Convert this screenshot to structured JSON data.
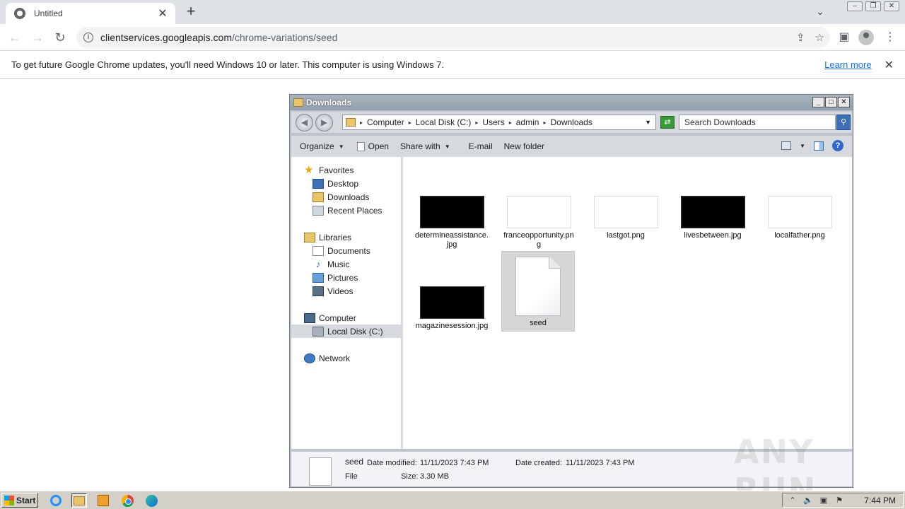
{
  "browser": {
    "tab_title": "Untitled",
    "new_tab": "+",
    "url_host": "clientservices.googleapis.com",
    "url_path": "/chrome-variations/seed",
    "infobar_message": "To get future Google Chrome updates, you'll need Windows 10 or later. This computer is using Windows 7.",
    "infobar_link": "Learn more"
  },
  "explorer": {
    "title": "Downloads",
    "breadcrumbs": [
      "Computer",
      "Local Disk (C:)",
      "Users",
      "admin",
      "Downloads"
    ],
    "search_placeholder": "Search Downloads",
    "commands": {
      "organize": "Organize",
      "open": "Open",
      "share_with": "Share with",
      "email": "E-mail",
      "new_folder": "New folder"
    },
    "nav": {
      "favorites": "Favorites",
      "desktop": "Desktop",
      "downloads": "Downloads",
      "recent_places": "Recent Places",
      "libraries": "Libraries",
      "documents": "Documents",
      "music": "Music",
      "pictures": "Pictures",
      "videos": "Videos",
      "computer": "Computer",
      "local_disk": "Local Disk (C:)",
      "network": "Network"
    },
    "files": [
      {
        "name": "determineassistance.jpg",
        "thumb": "black"
      },
      {
        "name": "franceopportunity.png",
        "thumb": "white"
      },
      {
        "name": "lastgot.png",
        "thumb": "white"
      },
      {
        "name": "livesbetween.jpg",
        "thumb": "black"
      },
      {
        "name": "localfather.png",
        "thumb": "white"
      },
      {
        "name": "magazinesession.jpg",
        "thumb": "black"
      },
      {
        "name": "seed",
        "thumb": "document"
      }
    ],
    "details": {
      "name": "seed",
      "type": "File",
      "modified_label": "Date modified:",
      "modified_value": "11/11/2023 7:43 PM",
      "created_label": "Date created:",
      "created_value": "11/11/2023 7:43 PM",
      "size_label": "Size:",
      "size_value": "3.30 MB"
    }
  },
  "taskbar": {
    "start": "Start",
    "clock": "7:44 PM"
  },
  "watermark": "ANY RUN"
}
